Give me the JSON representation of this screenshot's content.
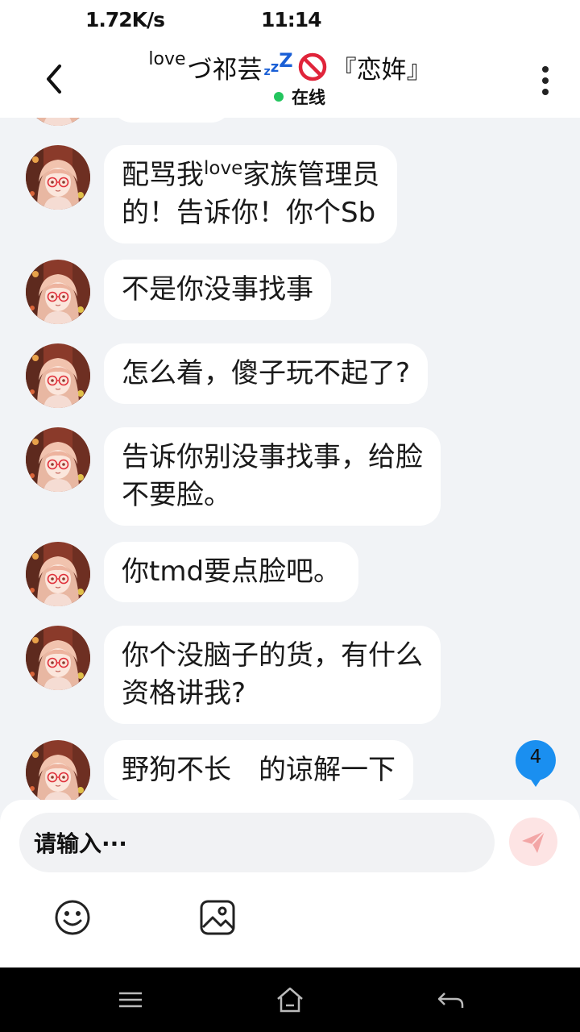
{
  "status_bar": {
    "speed": "1.72K/s",
    "time": "11:14"
  },
  "header": {
    "title_prefix": "love",
    "title_main": "づ祁芸",
    "title_zzz": [
      "z",
      "z",
      "Z"
    ],
    "title_suffix": "『恋姩』",
    "status_text": "在线",
    "status_color": "#23c55e"
  },
  "messages": [
    {
      "parts": [
        "配骂我",
        "love",
        "家族管理员"
      ],
      "line2": "的！告诉你！你个Sb"
    },
    {
      "text": "不是你没事找事"
    },
    {
      "text": "怎么着，傻子玩不起了?"
    },
    {
      "line1": "告诉你别没事找事，给脸",
      "line2": "不要脸。"
    },
    {
      "text": "你tmd要点脸吧。"
    },
    {
      "line1": "你个没脑子的货，有什么",
      "line2": "资格讲我?"
    },
    {
      "text": "野狗不长　的谅解一下"
    }
  ],
  "unread_badge": {
    "count": "4",
    "color": "#1a8ff0"
  },
  "input": {
    "placeholder": "请输入···"
  },
  "colors": {
    "background": "#f1f3f6",
    "bubble": "#ffffff",
    "send_button": "#fde4e4",
    "send_icon": "#f3a6a6"
  },
  "icons": {
    "back": "chevron-left-icon",
    "more": "more-vertical-icon",
    "prohibited": "prohibited-icon",
    "send": "paper-plane-icon",
    "emoji": "smile-icon",
    "image": "image-icon",
    "nav_menu": "menu-icon",
    "nav_home": "home-icon",
    "nav_back": "back-arrow-icon"
  }
}
